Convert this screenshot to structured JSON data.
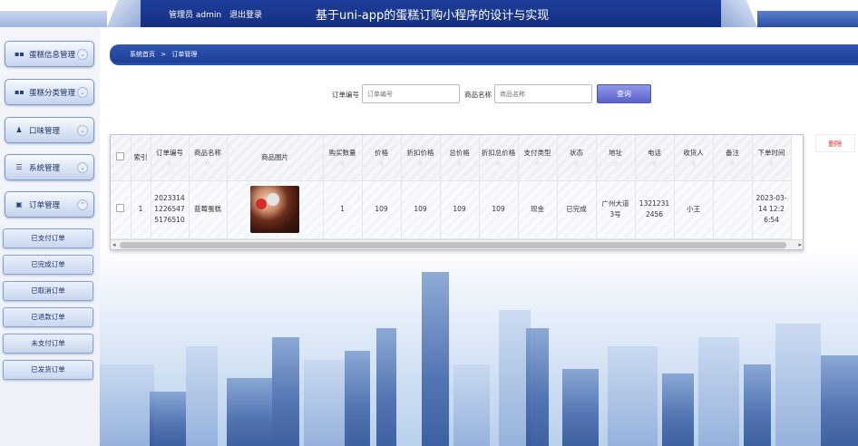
{
  "header": {
    "admin_label": "管理员 admin",
    "logout_label": "退出登录",
    "app_title": "基于uni-app的蛋糕订购小程序的设计与实现"
  },
  "sidebar": {
    "menus": [
      {
        "label": "蛋糕信息管理",
        "icon": "grid-icon",
        "arrow": "⌄"
      },
      {
        "label": "蛋糕分类管理",
        "icon": "grid-icon",
        "arrow": "⌄"
      },
      {
        "label": "口味管理",
        "icon": "user-icon",
        "arrow": "⌄"
      },
      {
        "label": "系统管理",
        "icon": "sliders-icon",
        "arrow": "⌄"
      },
      {
        "label": "订单管理",
        "icon": "clipboard-icon",
        "arrow": "⌃"
      }
    ],
    "order_sub_items": [
      "已支付订单",
      "已完成订单",
      "已取消订单",
      "已退款订单",
      "未支付订单",
      "已发货订单"
    ]
  },
  "breadcrumb": {
    "home": "系统首页",
    "separator": ">",
    "current": "订单管理"
  },
  "search": {
    "order_no_label": "订单编号",
    "order_no_placeholder": "订单编号",
    "product_name_label": "商品名称",
    "product_name_placeholder": "商品名称",
    "search_button": "查询"
  },
  "table": {
    "columns": [
      "索引",
      "订单编号",
      "商品名称",
      "商品图片",
      "购买数量",
      "价格",
      "折扣价格",
      "总价格",
      "折扣总价格",
      "支付类型",
      "状态",
      "地址",
      "电话",
      "收货人",
      "备注",
      "下单时间"
    ],
    "rows": [
      {
        "index": "1",
        "order_no": "202331412265475176510",
        "product_name": "蓝莓蛋糕",
        "quantity": "1",
        "price": "109",
        "discount_price": "109",
        "total_price": "109",
        "discount_total_price": "109",
        "pay_type": "现金",
        "status": "已完成",
        "address": "广州大道3号",
        "phone": "13212312456",
        "receiver": "小王",
        "remark": "",
        "order_time": "2023-03-14 12:26:54"
      }
    ]
  },
  "actions": {
    "delete_label": "删除"
  },
  "colors": {
    "header_bg": "#1e3f9a",
    "search_button": "#6d75d6",
    "delete_text": "#dd3333"
  }
}
